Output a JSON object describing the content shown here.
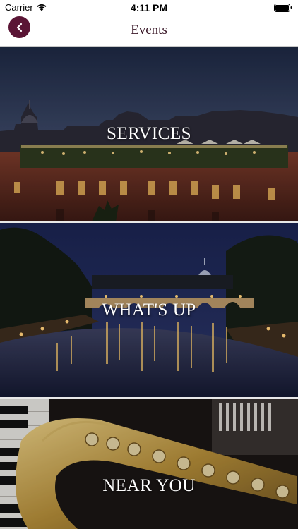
{
  "status_bar": {
    "carrier": "Carrier",
    "time": "4:11 PM"
  },
  "nav": {
    "title": "Events",
    "back_icon": "chevron-left-icon",
    "accent_color": "#5a1535"
  },
  "tiles": [
    {
      "label": "SERVICES"
    },
    {
      "label": "WHAT'S UP"
    },
    {
      "label": "NEAR YOU"
    }
  ]
}
